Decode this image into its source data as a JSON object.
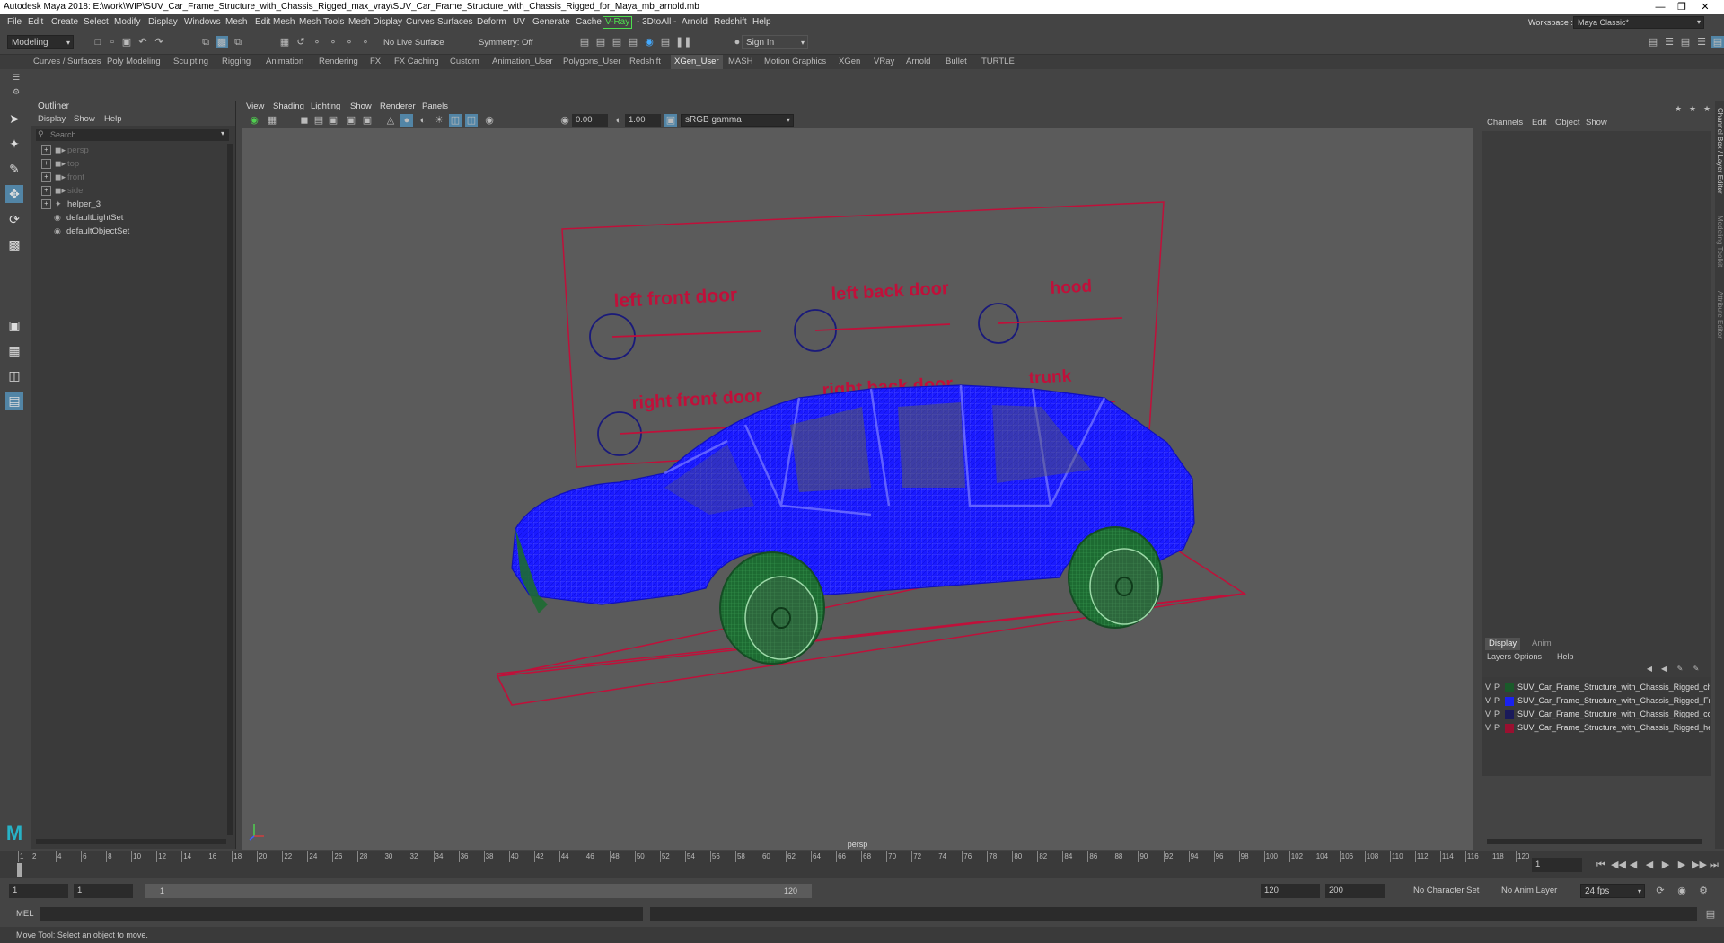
{
  "window": {
    "title": "Autodesk Maya 2018: E:\\work\\WIP\\SUV_Car_Frame_Structure_with_Chassis_Rigged_max_vray\\SUV_Car_Frame_Structure_with_Chassis_Rigged_for_Maya_mb_arnold.mb"
  },
  "menubar": {
    "items": [
      "File",
      "Edit",
      "Create",
      "Select",
      "Modify",
      "Display",
      "Windows",
      "Mesh",
      "Edit Mesh",
      "Mesh Tools",
      "Mesh Display",
      "Curves",
      "Surfaces",
      "Deform",
      "UV",
      "Generate",
      "Cache",
      "V-Ray",
      "- 3DtoAll -",
      "Arnold",
      "Redshift",
      "Help"
    ],
    "workspace_label": "Workspace :",
    "workspace_value": "Maya Classic*"
  },
  "toolbar": {
    "mode": "Modeling",
    "live_surface": "No Live Surface",
    "symmetry": "Symmetry: Off",
    "sign_in": "Sign In"
  },
  "shelf": {
    "tabs": [
      "Curves / Surfaces",
      "Poly Modeling",
      "Sculpting",
      "Rigging",
      "Animation",
      "Rendering",
      "FX",
      "FX Caching",
      "Custom",
      "Animation_User",
      "Polygons_User",
      "Redshift",
      "XGen_User",
      "MASH",
      "Motion Graphics",
      "XGen",
      "VRay",
      "Arnold",
      "Bullet",
      "TURTLE"
    ],
    "active": "XGen_User"
  },
  "outliner": {
    "title": "Outliner",
    "menu": [
      "Display",
      "Show",
      "Help"
    ],
    "search_placeholder": "Search...",
    "items": [
      {
        "label": "persp",
        "dim": true
      },
      {
        "label": "top",
        "dim": true
      },
      {
        "label": "front",
        "dim": true
      },
      {
        "label": "side",
        "dim": true
      },
      {
        "label": "helper_3",
        "dim": false
      },
      {
        "label": "defaultLightSet",
        "dim": false
      },
      {
        "label": "defaultObjectSet",
        "dim": false
      }
    ]
  },
  "viewport": {
    "menu": [
      "View",
      "Shading",
      "Lighting",
      "Show",
      "Renderer",
      "Panels"
    ],
    "exposure": "0.00",
    "gamma": "1.00",
    "color_space": "sRGB gamma",
    "camera_label": "persp",
    "controls": {
      "left_front_door": "left front door",
      "left_back_door": "left back door",
      "hood": "hood",
      "right_front_door": "right front door",
      "right_back_door": "right back door",
      "trunk": "trunk"
    }
  },
  "channelbox": {
    "menu": [
      "Channels",
      "Edit",
      "Object",
      "Show"
    ],
    "tabs": [
      "Display",
      "Anim"
    ],
    "layer_menu": [
      "Layers",
      "Options",
      "Help"
    ],
    "layers": [
      {
        "v": "V",
        "p": "P",
        "color": "#1a5a2a",
        "name": "SUV_Car_Frame_Structure_with_Chassis_Rigged_chassis"
      },
      {
        "v": "V",
        "p": "P",
        "color": "#1a22ee",
        "name": "SUV_Car_Frame_Structure_with_Chassis_Rigged_Frame"
      },
      {
        "v": "V",
        "p": "P",
        "color": "#1a1a5a",
        "name": "SUV_Car_Frame_Structure_with_Chassis_Rigged_controllers"
      },
      {
        "v": "V",
        "p": "P",
        "color": "#9a1030",
        "name": "SUV_Car_Frame_Structure_with_Chassis_Rigged_helpers"
      }
    ],
    "side_tabs": [
      "Channel Box / Layer Editor",
      "Modeling Toolkit",
      "Attribute Editor"
    ]
  },
  "timeline": {
    "ticks": [
      "1",
      "2",
      "4",
      "6",
      "8",
      "10",
      "12",
      "14",
      "16",
      "18",
      "20",
      "22",
      "24",
      "26",
      "28",
      "30",
      "32",
      "34",
      "36",
      "38",
      "40",
      "42",
      "44",
      "46",
      "48",
      "50",
      "52",
      "54",
      "56",
      "58",
      "60",
      "62",
      "64",
      "66",
      "68",
      "70",
      "72",
      "74",
      "76",
      "78",
      "80",
      "82",
      "84",
      "86",
      "88",
      "90",
      "92",
      "94",
      "96",
      "98",
      "100",
      "102",
      "104",
      "106",
      "108",
      "110",
      "112",
      "114",
      "116",
      "118",
      "120"
    ],
    "current_frame": "1"
  },
  "range": {
    "start": "1",
    "anim_start": "1",
    "slider_start": "1",
    "slider_end": "120",
    "anim_end": "120",
    "end": "200",
    "character_set": "No Character Set",
    "anim_layer": "No Anim Layer",
    "fps": "24 fps"
  },
  "cmd": {
    "label": "MEL"
  },
  "help": {
    "text": "Move Tool: Select an object to move."
  },
  "colors": {
    "wire_blue": "#1a1aff",
    "wheel_green": "#1d6b32",
    "control_red": "#c0103a",
    "selection": "#5285a6"
  }
}
